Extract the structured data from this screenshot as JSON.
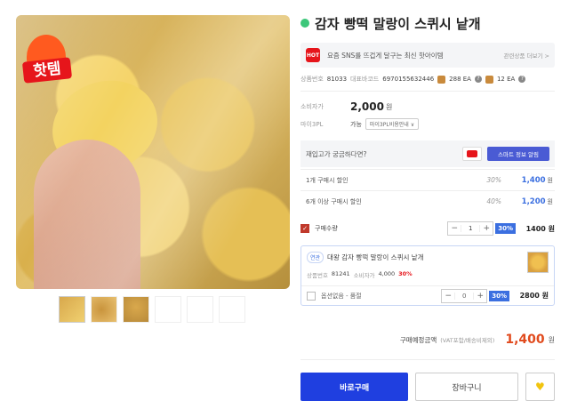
{
  "hot_badge": "핫템",
  "product": {
    "title": "감자 빵떡 말랑이 스퀴시 낱개",
    "promo_text": "요즘 SNS를 뜨겁게 달구는 최신 핫아이템",
    "promo_more": "관련상품 더보기 >",
    "code_label": "상품번호",
    "code": "81033",
    "barcode_label": "대표바코드",
    "barcode": "6970155632446",
    "box_qty": "288 EA",
    "pack_qty": "12 EA"
  },
  "price": {
    "consumer_label": "소비자가",
    "consumer_value": "2,000",
    "won": "원",
    "ship_label": "마이3PL",
    "ship_possible": "가능",
    "ship_select": "마이3PL비용안내 ∨"
  },
  "inquiry": {
    "text": "재입고가 궁금하다면?",
    "smart_button": "스마트 정보 알림"
  },
  "discounts": [
    {
      "label": "1개 구매시 할인",
      "rate": "30%",
      "price": "1,400",
      "unit": "원"
    },
    {
      "label": "6개 이상 구매시 할인",
      "rate": "40%",
      "price": "1,200",
      "unit": "원"
    }
  ],
  "qty": {
    "label": "구매수량",
    "value": "1",
    "pct": "30%",
    "price": "1400 원"
  },
  "assoc": {
    "tag": "연관",
    "title": "대왕 감자 빵떡 말랑이 스퀴시 낱개",
    "code_label": "상품번호",
    "code": "81241",
    "consumer_label": "소비자가",
    "consumer": "4,000",
    "pct": "30%",
    "opt_label": "옵션없음 - 품절",
    "opt_value": "0",
    "opt_pct": "30%",
    "opt_price": "2800 원"
  },
  "total": {
    "label": "구매예정금액",
    "sub": "(VAT포함/배송비제외)",
    "amount": "1,400",
    "won": "원"
  },
  "buttons": {
    "buy": "바로구매",
    "cart": "장바구니"
  },
  "colors": {
    "accent": "#1f3fe0",
    "discount_blue": "#3b6fe0",
    "total_red": "#e14b1e",
    "hot_red": "#e6151b"
  }
}
